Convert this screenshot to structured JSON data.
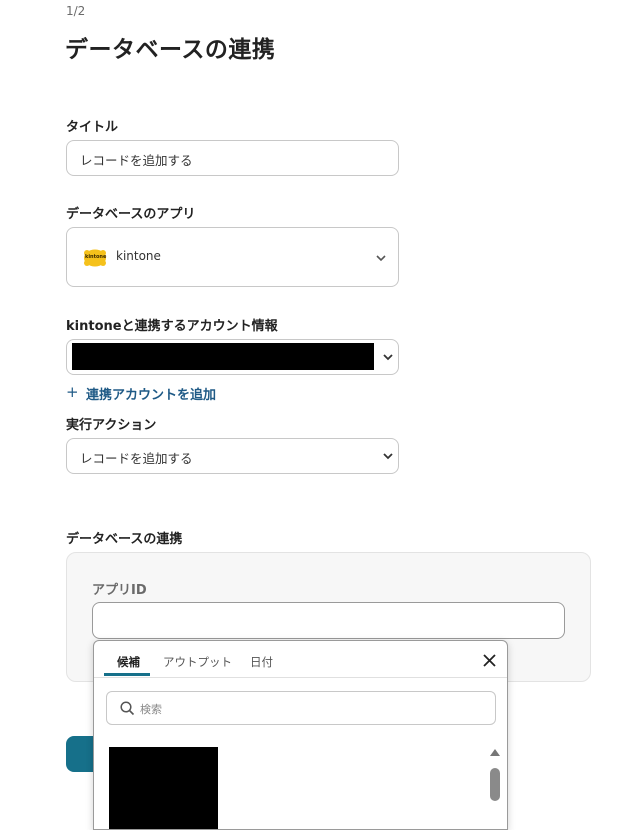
{
  "header": {
    "step": "1/2",
    "title": "データベースの連携"
  },
  "form": {
    "title_label": "タイトル",
    "title_value": "レコードを追加する",
    "app_label": "データベースのアプリ",
    "app_logo_text": "kintone",
    "app_value": "kintone",
    "account_label": "kintoneと連携するアカウント情報",
    "add_account": "連携アカウントを追加",
    "action_label": "実行アクション",
    "action_value": "レコードを追加する"
  },
  "db": {
    "section_label": "データベースの連携",
    "app_id_label": "アプリID",
    "app_id_value": ""
  },
  "popup": {
    "tabs": [
      "候補",
      "アウトプット",
      "日付"
    ],
    "active_tab": "候補",
    "search_placeholder": "検索"
  },
  "colors": {
    "accent": "#16708a",
    "link": "#1f5a86",
    "logo_yellow": "#f5c11b"
  }
}
